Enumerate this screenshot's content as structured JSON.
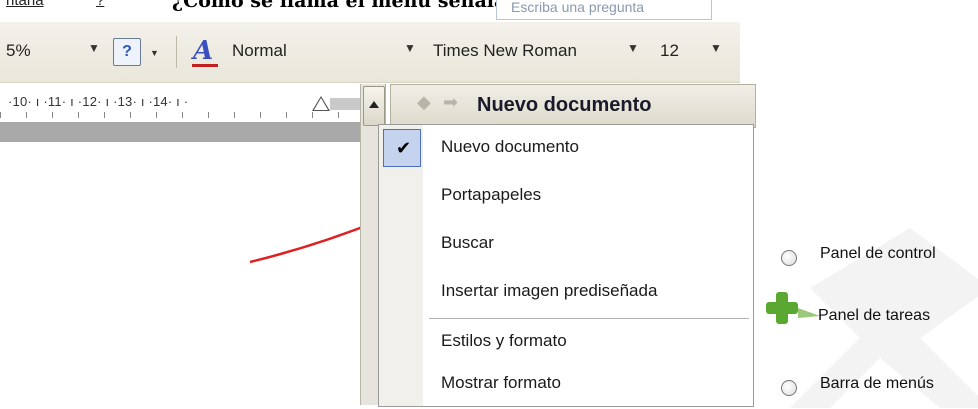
{
  "header": {
    "menu_window": "ntana",
    "menu_help": "?",
    "question": "¿Cómo se llama el menú señalado?",
    "ask_placeholder": "Escriba una pregunta"
  },
  "toolbar": {
    "zoom_value": "5%",
    "style_value": "Normal",
    "font_value": "Times New Roman",
    "size_value": "12",
    "help_label": "?"
  },
  "ruler": {
    "text": "·10· ı ·11· ı ·12· ı ·13· ı ·14· ı ·"
  },
  "task_pane": {
    "title": "Nuevo documento",
    "nav_back": "◆",
    "nav_forward": "➡",
    "menu_items": [
      {
        "label": "Nuevo documento",
        "checked": true
      },
      {
        "label": "Portapapeles"
      },
      {
        "label": "Buscar"
      },
      {
        "label": "Insertar imagen prediseñada"
      },
      {
        "label": "Estilos y formato"
      },
      {
        "label": "Mostrar formato"
      }
    ]
  },
  "quiz_options": [
    {
      "label": "Panel de control",
      "marker": "radio"
    },
    {
      "label": "Panel de tareas",
      "marker": "correct-plus"
    },
    {
      "label": "Barra de menús",
      "marker": "radio"
    }
  ],
  "colors": {
    "arrow": "#e02020",
    "plus": "#5aa832",
    "checked_bg": "#c6d3ee"
  }
}
